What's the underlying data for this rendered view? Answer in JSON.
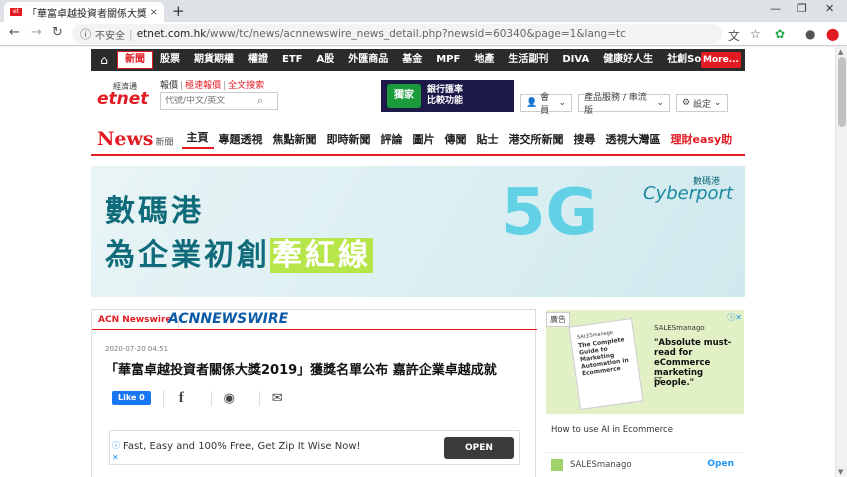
{
  "browser": {
    "tab_title": "「華富卓越投資者關係大獎2019」",
    "tab_close": "×",
    "new_tab": "+",
    "win_min": "—",
    "win_max": "❐",
    "win_close": "✕",
    "not_secure": "不安全",
    "url_host": "etnet.com.hk",
    "url_path": "/www/tc/news/acnnewswire_news_detail.php?newsid=60340&page=1&lang=tc"
  },
  "topnav": {
    "home_icon": "home-icon",
    "items": [
      "新聞",
      "股票",
      "期貨期權",
      "權證",
      "ETF",
      "A股",
      "外匯商品",
      "基金",
      "MPF",
      "地產",
      "生活副刊",
      "DIVA",
      "健康好人生",
      "社創SoIN"
    ],
    "more": "More..."
  },
  "logo": {
    "cn": "經濟通",
    "en": "etnet"
  },
  "quicklinks": {
    "l1": "報價",
    "l2": "極速報價",
    "l3": "全文搜索"
  },
  "search": {
    "placeholder": "代號/中文/英文"
  },
  "adbanner": {
    "tag": "獨家",
    "msg1": "銀行匯率",
    "msg2": "比較功能"
  },
  "userbar": {
    "member": "會員",
    "products": "產品服務 / 串流版",
    "settings": "設定"
  },
  "secnav": {
    "news": "News",
    "news_cn": "新聞",
    "items": [
      "主頁",
      "專題透視",
      "焦點新聞",
      "即時新聞",
      "評論",
      "圖片",
      "傳聞",
      "貼士",
      "港交所新聞",
      "搜尋",
      "透視大灣區",
      "理財easy助"
    ]
  },
  "hero": {
    "line1": "數碼港",
    "line2a": "為企業初創",
    "line2b": "牽紅線",
    "tag": "5G",
    "brand_cn": "數碼港",
    "brand_en": "Cyberport"
  },
  "article": {
    "source_label": "ACN Newswire",
    "source_logo": "ACNNEWSWIRE",
    "date": "2020-07-20 04:51",
    "headline": "「華富卓越投資者關係大獎2019」獲獎名單公布 嘉許企業卓越成就",
    "like": "Like 0"
  },
  "inline_ad": {
    "text": "Fast, Easy and 100% Free, Get Zip It Wise Now!",
    "button": "OPEN"
  },
  "side_ad": {
    "label": "廣告",
    "book_brand": "SALESmanago",
    "book_title": "The Complete Guide to Marketing Automation in Ecommerce",
    "brand": "SALESmanago",
    "quote": "\"Absolute must-read for eCommerce marketing people.\"",
    "ft": "FT",
    "caption": "How to use AI in Ecommerce",
    "advertiser": "SALESmanago",
    "open": "Open"
  },
  "colors": {
    "accent": "#e21b23",
    "nav_bg": "#2b2b2b",
    "acn_blue": "#0b5aa8"
  }
}
